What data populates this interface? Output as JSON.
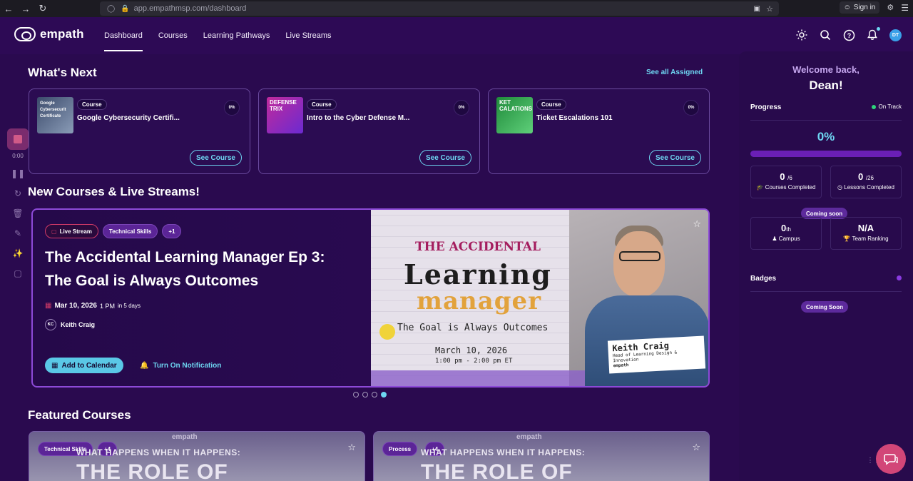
{
  "browser": {
    "url_domain": "app.empathmsp.com",
    "url_path": "/dashboard",
    "signin_label": "Sign in"
  },
  "header": {
    "logo": "empath",
    "nav": [
      {
        "label": "Dashboard",
        "active": true
      },
      {
        "label": "Courses",
        "active": false
      },
      {
        "label": "Learning Pathways",
        "active": false
      },
      {
        "label": "Live Streams",
        "active": false
      }
    ],
    "icons": [
      "sun-icon",
      "search-icon",
      "help-icon",
      "bell-icon"
    ],
    "avatar_initials": "DT"
  },
  "recorder": {
    "time": "0:00"
  },
  "whats_next": {
    "title": "What's Next",
    "see_all": "See all Assigned",
    "cards": [
      {
        "badge": "Course",
        "name": "Google Cybersecurity Certifi...",
        "progress": "0%",
        "button": "See Course",
        "thumb_text": "Google Cybersecurit Certificate"
      },
      {
        "badge": "Course",
        "name": "Intro to the Cyber Defense M...",
        "progress": "0%",
        "button": "See Course",
        "thumb_text": "DEFENSE TRIX"
      },
      {
        "badge": "Course",
        "name": "Ticket Escalations 101",
        "progress": "0%",
        "button": "See Course",
        "thumb_text": "KET CALATIONS"
      }
    ]
  },
  "new_courses": {
    "title": "New Courses & Live Streams!",
    "hero": {
      "chips": [
        "Live Stream",
        "Technical Skills",
        "+1"
      ],
      "title": "The Accidental Learning Manager Ep 3: The Goal is Always Outcomes",
      "date": "Mar 10, 2026",
      "time": "1 PM",
      "relative": "in 5 days",
      "speaker_initials": "KC",
      "speaker": "Keith Craig",
      "add_calendar": "Add to Calendar",
      "notification": "Turn On Notification",
      "image": {
        "line1": "THE ACCIDENTAL",
        "line2": "Learning",
        "line3": "manager",
        "line4": "The Goal is Always Outcomes",
        "line5": "March 10, 2026",
        "line6": "1:00 pm - 2:00 pm ET",
        "plate_name": "Keith Craig",
        "plate_role": "Head of Learning Design & Innovation",
        "plate_logo": "empath"
      }
    },
    "carousel": {
      "count": 4,
      "active_index": 3
    }
  },
  "featured": {
    "title": "Featured Courses",
    "cards": [
      {
        "chip": "Technical Skills",
        "plus": "+4",
        "logo": "empath",
        "headline": "WHAT HAPPENS WHEN IT HAPPENS:",
        "big": "THE ROLE OF"
      },
      {
        "chip": "Process",
        "plus": "+4",
        "logo": "empath",
        "headline": "WHAT HAPPENS WHEN IT HAPPENS:",
        "big": "THE ROLE OF"
      }
    ]
  },
  "sidebar": {
    "welcome": "Welcome back,",
    "name": "Dean!",
    "progress_label": "Progress",
    "status": "On Track",
    "status_color": "#2ed47a",
    "percent": "0%",
    "percent_value": 0,
    "courses_completed": {
      "value": "0",
      "total": "/6",
      "label": "Courses Completed"
    },
    "lessons_completed": {
      "value": "0",
      "total": "/26",
      "label": "Lessons Completed"
    },
    "coming_soon_1": "Coming soon",
    "campus": {
      "value": "0",
      "suffix": "th",
      "label": "Campus"
    },
    "team_ranking": {
      "value": "N/A",
      "label": "Team Ranking"
    },
    "badges_label": "Badges",
    "coming_soon_2": "Coming Soon"
  },
  "colors": {
    "accent": "#6ed6f2",
    "bg": "#2a0a4f",
    "live": "#d23a68"
  }
}
